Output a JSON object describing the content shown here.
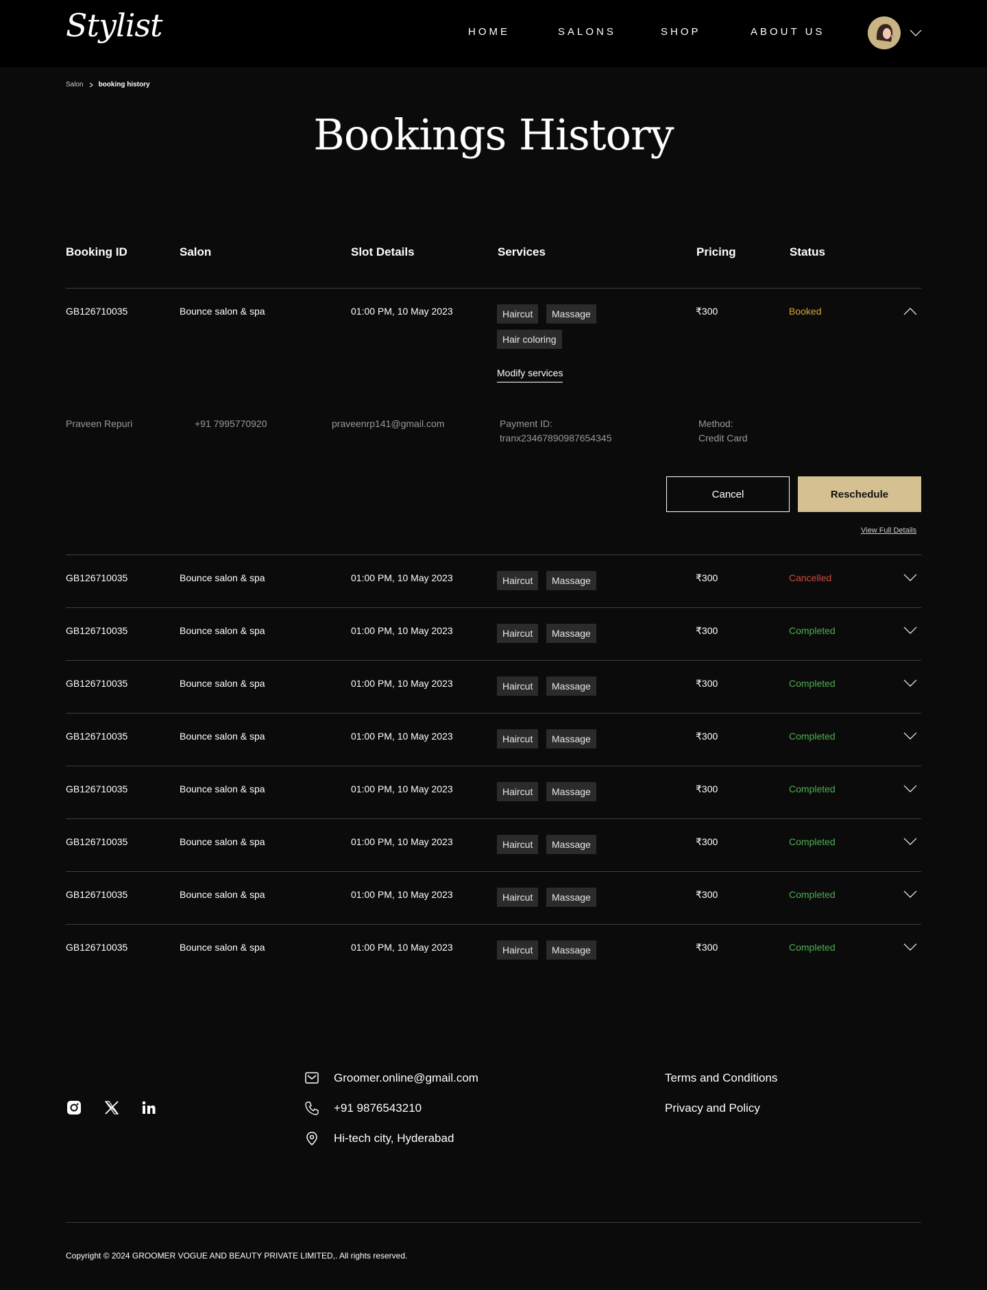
{
  "brand": {
    "logo": "Stylist"
  },
  "nav": {
    "items": [
      "HOME",
      "SALONS",
      "SHOP",
      "ABOUT US"
    ]
  },
  "breadcrumb": {
    "items": [
      "Salon",
      "booking history"
    ]
  },
  "page": {
    "title": "Bookings History"
  },
  "table": {
    "columns": [
      "Booking ID",
      "Salon",
      "Slot Details",
      "Services",
      "Pricing",
      "Status"
    ],
    "rows": [
      {
        "id": "GB126710035",
        "salon": "Bounce salon & spa",
        "slot": "01:00 PM, 10 May 2023",
        "services": [
          "Haircut",
          "Massage",
          "Hair coloring"
        ],
        "price": "₹300",
        "status": "Booked",
        "expanded": true
      },
      {
        "id": "GB126710035",
        "salon": "Bounce salon & spa",
        "slot": "01:00 PM, 10 May 2023",
        "services": [
          "Haircut",
          "Massage"
        ],
        "price": "₹300",
        "status": "Cancelled",
        "expanded": false
      },
      {
        "id": "GB126710035",
        "salon": "Bounce salon & spa",
        "slot": "01:00 PM, 10 May 2023",
        "services": [
          "Haircut",
          "Massage"
        ],
        "price": "₹300",
        "status": "Completed",
        "expanded": false
      },
      {
        "id": "GB126710035",
        "salon": "Bounce salon & spa",
        "slot": "01:00 PM, 10 May 2023",
        "services": [
          "Haircut",
          "Massage"
        ],
        "price": "₹300",
        "status": "Completed",
        "expanded": false
      },
      {
        "id": "GB126710035",
        "salon": "Bounce salon & spa",
        "slot": "01:00 PM, 10 May 2023",
        "services": [
          "Haircut",
          "Massage"
        ],
        "price": "₹300",
        "status": "Completed",
        "expanded": false
      },
      {
        "id": "GB126710035",
        "salon": "Bounce salon & spa",
        "slot": "01:00 PM, 10 May 2023",
        "services": [
          "Haircut",
          "Massage"
        ],
        "price": "₹300",
        "status": "Completed",
        "expanded": false
      },
      {
        "id": "GB126710035",
        "salon": "Bounce salon & spa",
        "slot": "01:00 PM, 10 May 2023",
        "services": [
          "Haircut",
          "Massage"
        ],
        "price": "₹300",
        "status": "Completed",
        "expanded": false
      },
      {
        "id": "GB126710035",
        "salon": "Bounce salon & spa",
        "slot": "01:00 PM, 10 May 2023",
        "services": [
          "Haircut",
          "Massage"
        ],
        "price": "₹300",
        "status": "Completed",
        "expanded": false
      },
      {
        "id": "GB126710035",
        "salon": "Bounce salon & spa",
        "slot": "01:00 PM, 10 May 2023",
        "services": [
          "Haircut",
          "Massage"
        ],
        "price": "₹300",
        "status": "Completed",
        "expanded": false
      }
    ]
  },
  "details": {
    "modify_label": "Modify services",
    "customer_name": "Praveen Repuri",
    "phone": "+91 7995770920",
    "email": "praveenrp141@gmail.com",
    "payment_label": "Payment ID:",
    "payment_id": "tranx23467890987654345",
    "method_label": "Method:",
    "method": "Credit Card",
    "cancel_label": "Cancel",
    "reschedule_label": "Reschedule",
    "view_full_label": "View Full Details"
  },
  "status_colors": {
    "Booked": "#d9a440",
    "Cancelled": "#d14a3f",
    "Completed": "#4caf50"
  },
  "accent_color": "#d4c090",
  "footer": {
    "email": "Groomer.online@gmail.com",
    "phone": "+91 9876543210",
    "address": "Hi-tech city, Hyderabad",
    "terms": "Terms and Conditions",
    "privacy": "Privacy and Policy",
    "copyright": "Copyright  ©  2024 GROOMER VOGUE AND BEAUTY PRIVATE LIMITED,. All rights reserved.",
    "social_icons": [
      "instagram-icon",
      "x-icon",
      "linkedin-icon"
    ]
  }
}
